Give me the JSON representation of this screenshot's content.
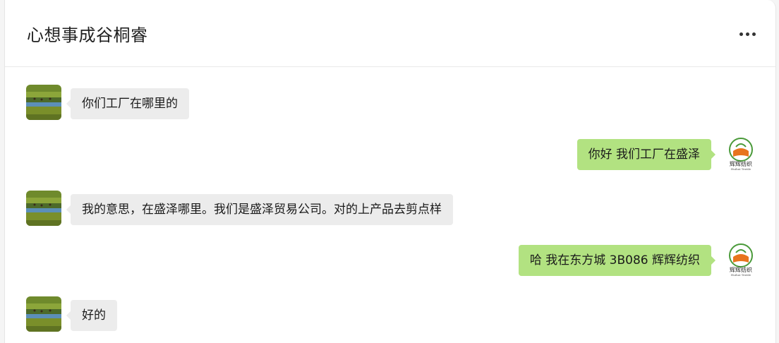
{
  "chat": {
    "title": "心想事成谷桐睿",
    "more_icon": "more-horizontal-icon"
  },
  "messages": [
    {
      "side": "in",
      "text": "你们工厂在哪里的"
    },
    {
      "side": "out",
      "text": "你好  我们工厂在盛泽"
    },
    {
      "side": "in",
      "text": "我的意思，在盛泽哪里。我们是盛泽贸易公司。对的上产品去剪点样"
    },
    {
      "side": "out",
      "text": "哈  我在东方城  3B086  辉辉纺织"
    },
    {
      "side": "in",
      "text": "好的"
    }
  ],
  "sender_logo": {
    "name": "辉辉纺织",
    "script": "Huihui Textile"
  },
  "colors": {
    "incoming_bubble": "#ececec",
    "outgoing_bubble": "#b2e281",
    "logo_orange": "#e8741e",
    "logo_green": "#4a9a3a"
  }
}
